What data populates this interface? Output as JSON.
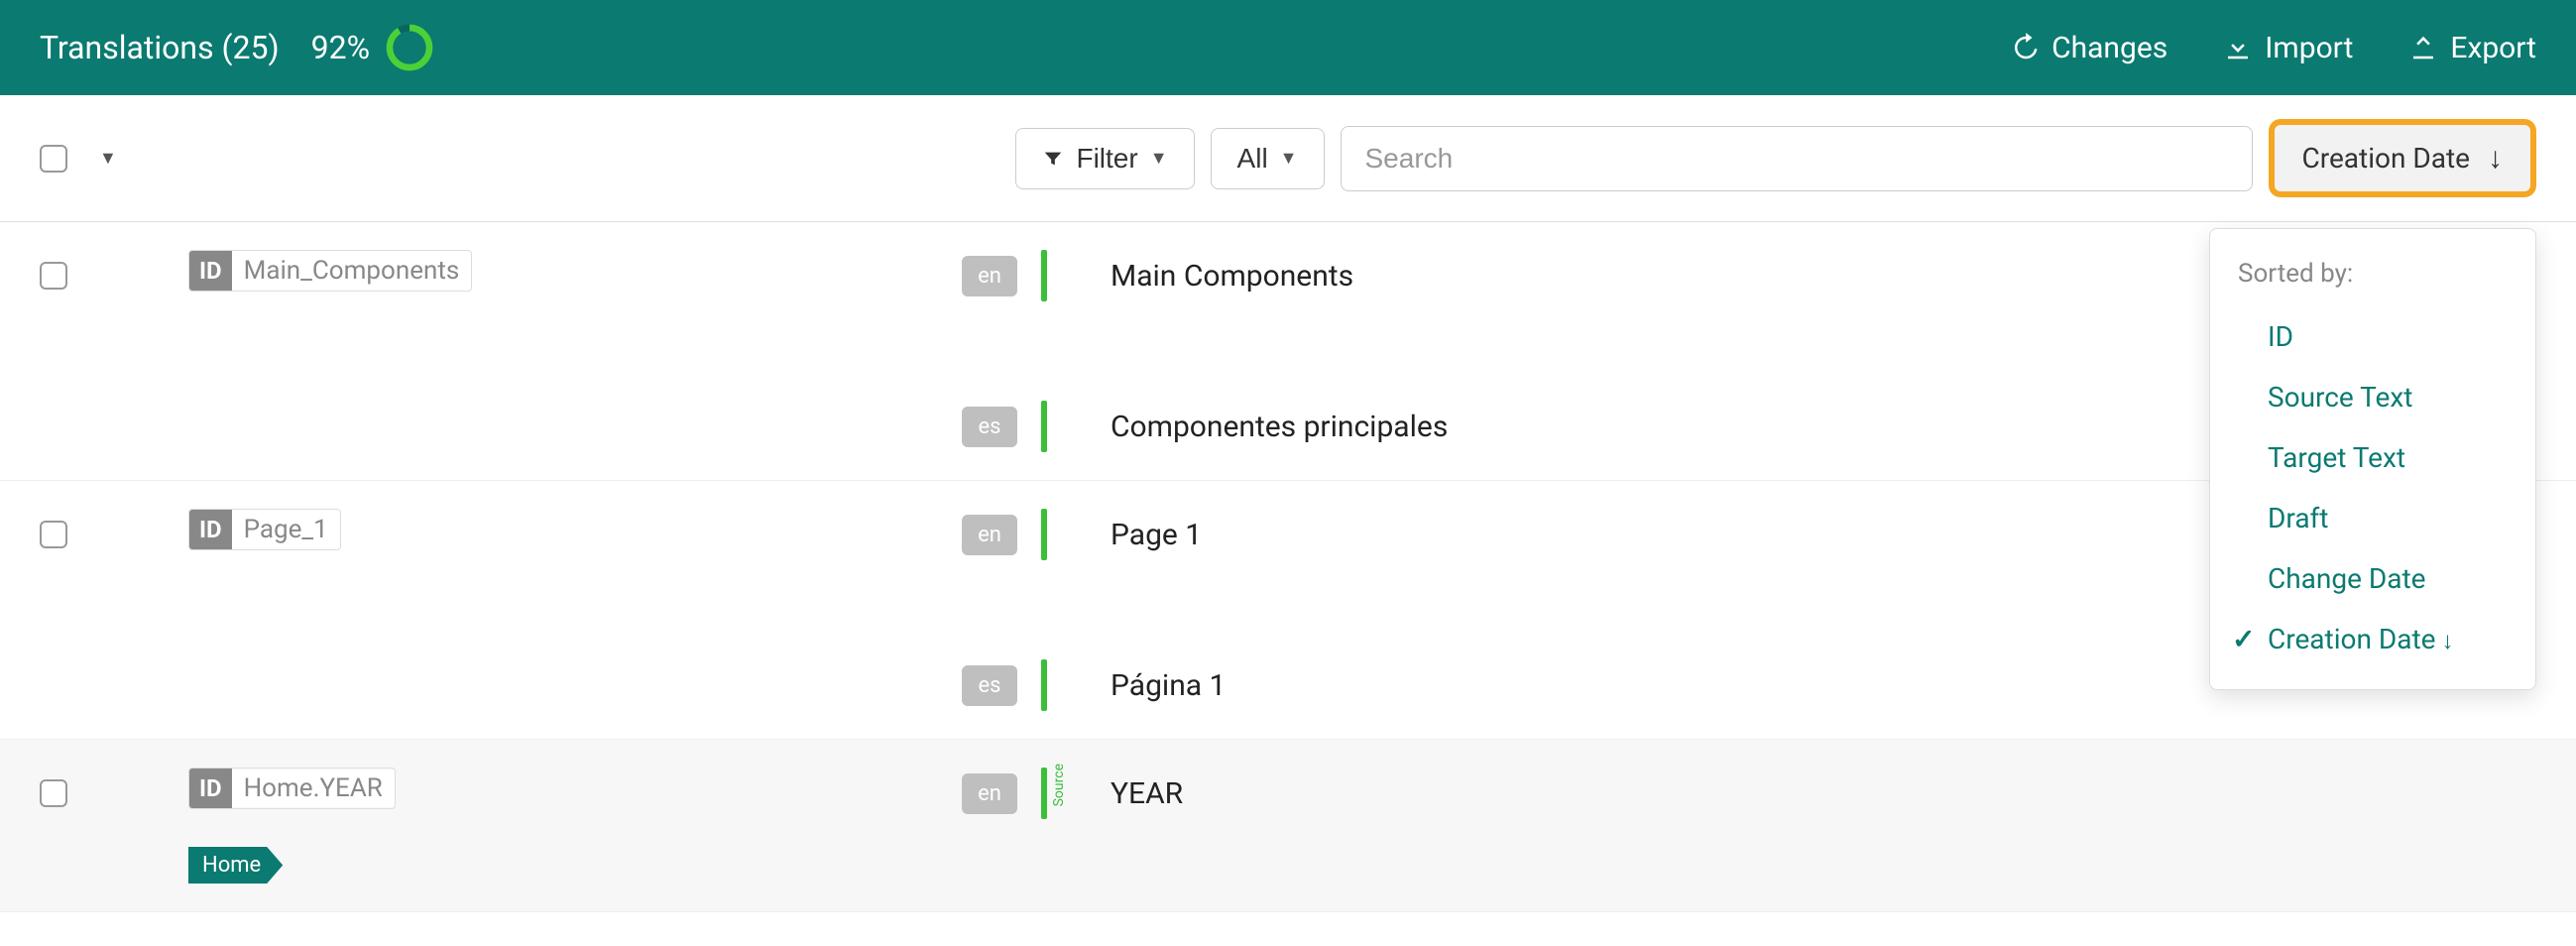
{
  "header": {
    "title": "Translations (25)",
    "percent": "92%",
    "changes": "Changes",
    "import": "Import",
    "export": "Export"
  },
  "toolbar": {
    "filter": "Filter",
    "scope": "All",
    "search_placeholder": "Search",
    "sort_label": "Creation Date"
  },
  "sort_menu": {
    "title": "Sorted by:",
    "items": {
      "id": "ID",
      "source": "Source Text",
      "target": "Target Text",
      "draft": "Draft",
      "change": "Change Date",
      "creation": "Creation Date"
    }
  },
  "rows": {
    "r0": {
      "id": "Main_Components",
      "en": {
        "lang": "en",
        "text": "Main Components"
      },
      "es": {
        "lang": "es",
        "text": "Componentes principales"
      }
    },
    "r1": {
      "id": "Page_1",
      "en": {
        "lang": "en",
        "text": "Page 1"
      },
      "es": {
        "lang": "es",
        "text": "Página 1"
      }
    },
    "r2": {
      "id": "Home.YEAR",
      "tag": "Home",
      "en": {
        "lang": "en",
        "text": "YEAR"
      },
      "source_label": "Source"
    }
  },
  "labels": {
    "idbadge": "ID"
  }
}
